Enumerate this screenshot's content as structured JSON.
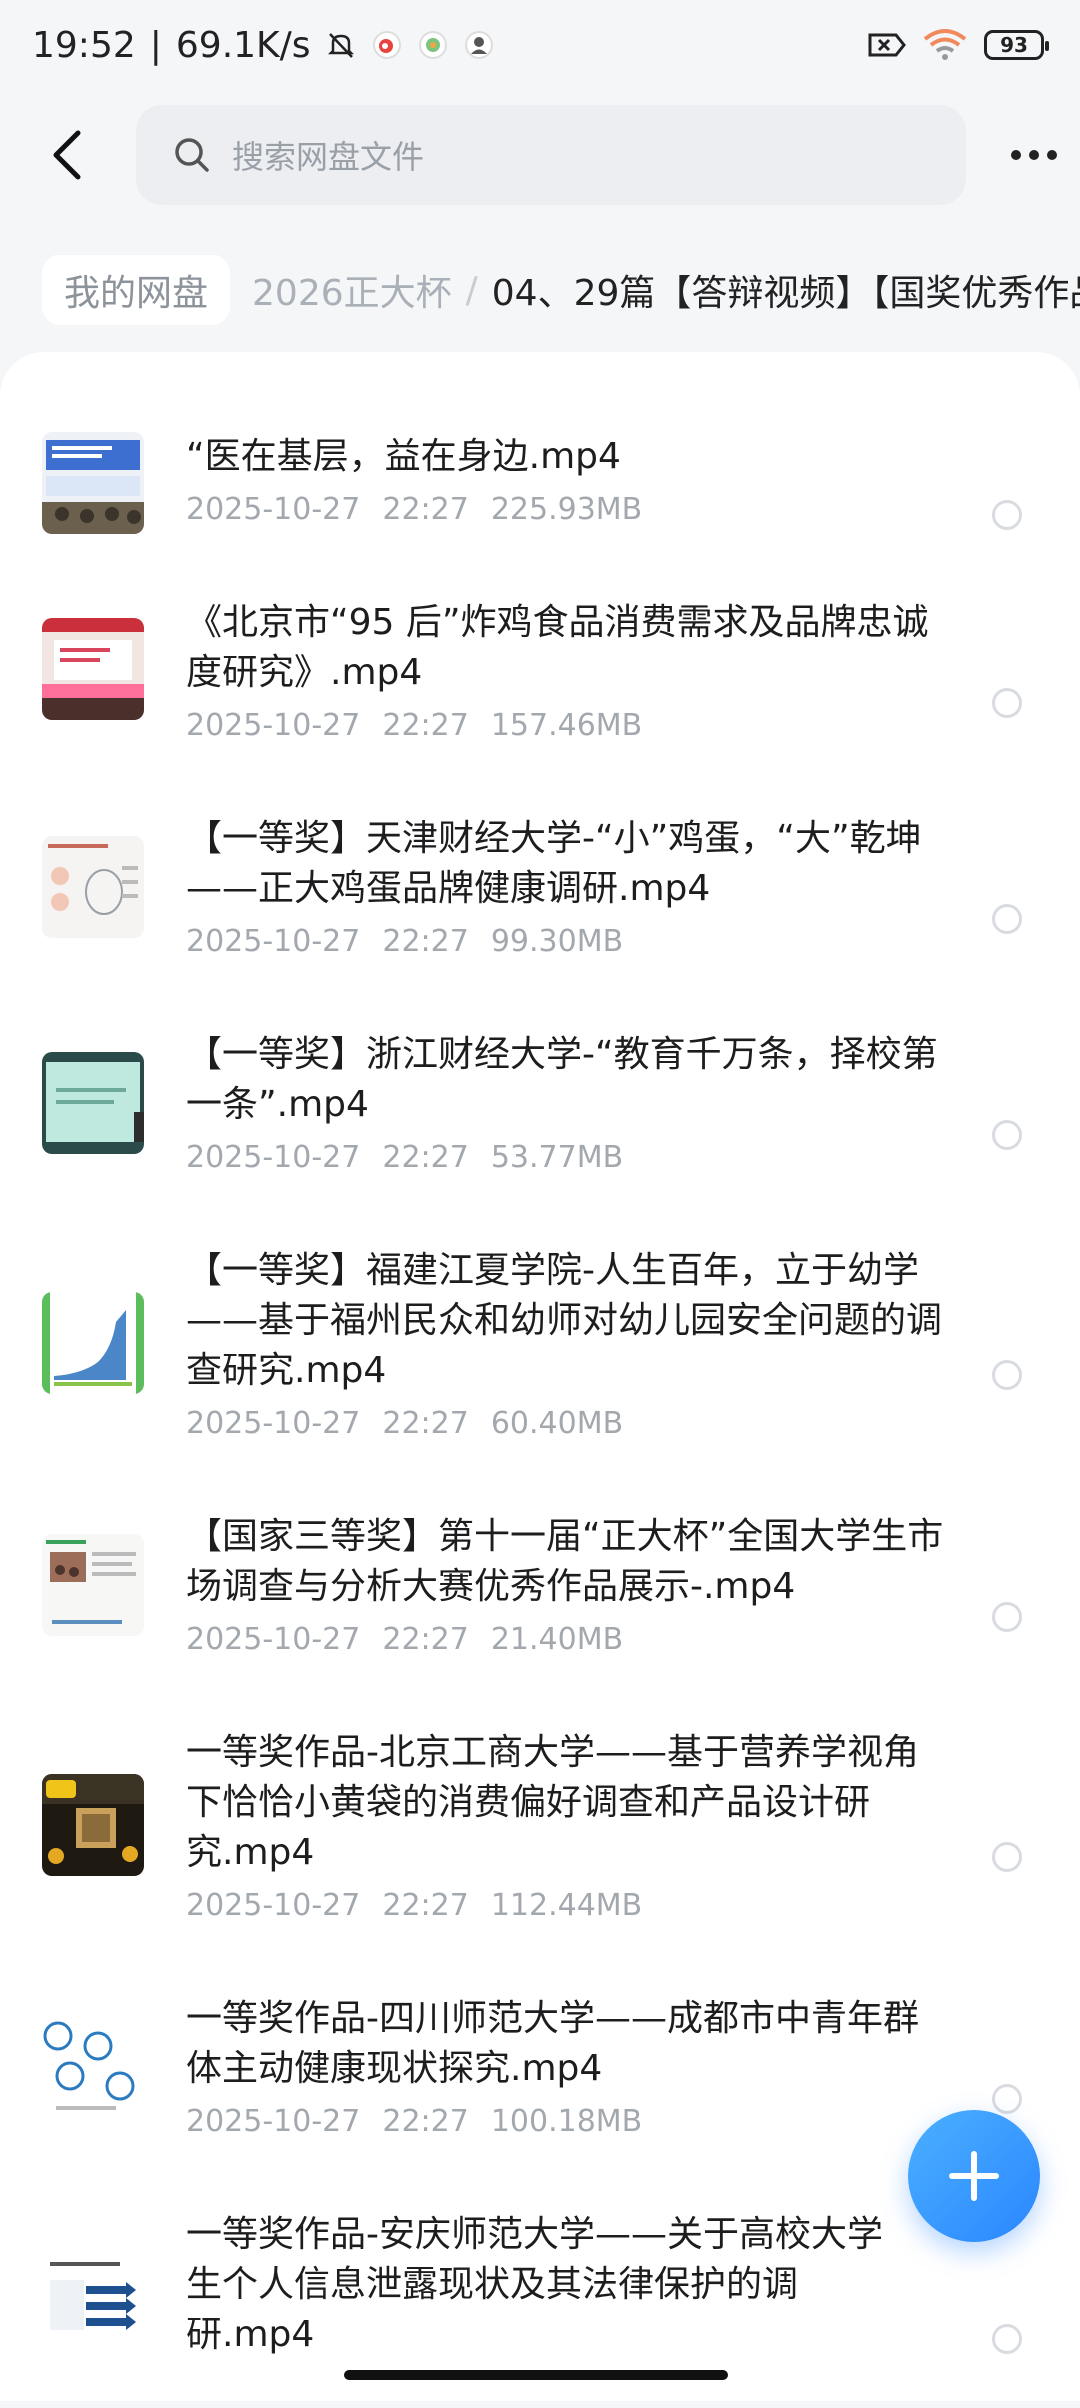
{
  "status_bar": {
    "time": "19:52",
    "speed": "69.1K/s",
    "battery": "93"
  },
  "search": {
    "placeholder": "搜索网盘文件"
  },
  "breadcrumb": {
    "root": "我的网盘",
    "mid": "2026正大杯",
    "separator": "/",
    "current": "04、29篇【答辩视频】【国奖优秀作品"
  },
  "files": [
    {
      "name": "“医在基层，益在身边.mp4",
      "date": "2025-10-27",
      "time": "22:27",
      "size": "225.93MB",
      "thumb": "slides-blue-audience"
    },
    {
      "name": "《北京市“95 后”炸鸡食品消费需求及品牌忠诚度研究》.mp4",
      "date": "2025-10-27",
      "time": "22:27",
      "size": "157.46MB",
      "thumb": "stage-red-banner"
    },
    {
      "name": "【一等奖】天津财经大学-“小”鸡蛋，“大”乾坤——正大鸡蛋品牌健康调研.mp4",
      "date": "2025-10-27",
      "time": "22:27",
      "size": "99.30MB",
      "thumb": "slide-diagram"
    },
    {
      "name": "【一等奖】浙江财经大学-“教育千万条，择校第一条”.mp4",
      "date": "2025-10-27",
      "time": "22:27",
      "size": "53.77MB",
      "thumb": "slide-green"
    },
    {
      "name": "【一等奖】福建江夏学院-人生百年，立于幼学——基于福州民众和幼师对幼儿园安全问题的调查研究.mp4",
      "date": "2025-10-27",
      "time": "22:27",
      "size": "60.40MB",
      "thumb": "chart-blue"
    },
    {
      "name": "【国家三等奖】第十一届“正大杯”全国大学生市场调查与分析大赛优秀作品展示-.mp4",
      "date": "2025-10-27",
      "time": "22:27",
      "size": "21.40MB",
      "thumb": "slide-photo"
    },
    {
      "name": "一等奖作品-北京工商大学——基于营养学视角下恰恰小黄袋的消费偏好调查和产品设计研究.mp4",
      "date": "2025-10-27",
      "time": "22:27",
      "size": "112.44MB",
      "thumb": "slide-dark-product"
    },
    {
      "name": "一等奖作品-四川师范大学——成都市中青年群体主动健康现状探究.mp4",
      "date": "2025-10-27",
      "time": "22:27",
      "size": "100.18MB",
      "thumb": "slide-circles"
    },
    {
      "name": "一等奖作品-安庆师范大学——关于高校大学生个人信息泄露现状及其法律保护的调研.mp4",
      "date": "",
      "time": "",
      "size": "",
      "thumb": "slide-arrows"
    }
  ],
  "icons": {
    "back": "back-arrow-icon",
    "search": "search-icon",
    "more": "more-icon",
    "fab": "plus-icon"
  }
}
